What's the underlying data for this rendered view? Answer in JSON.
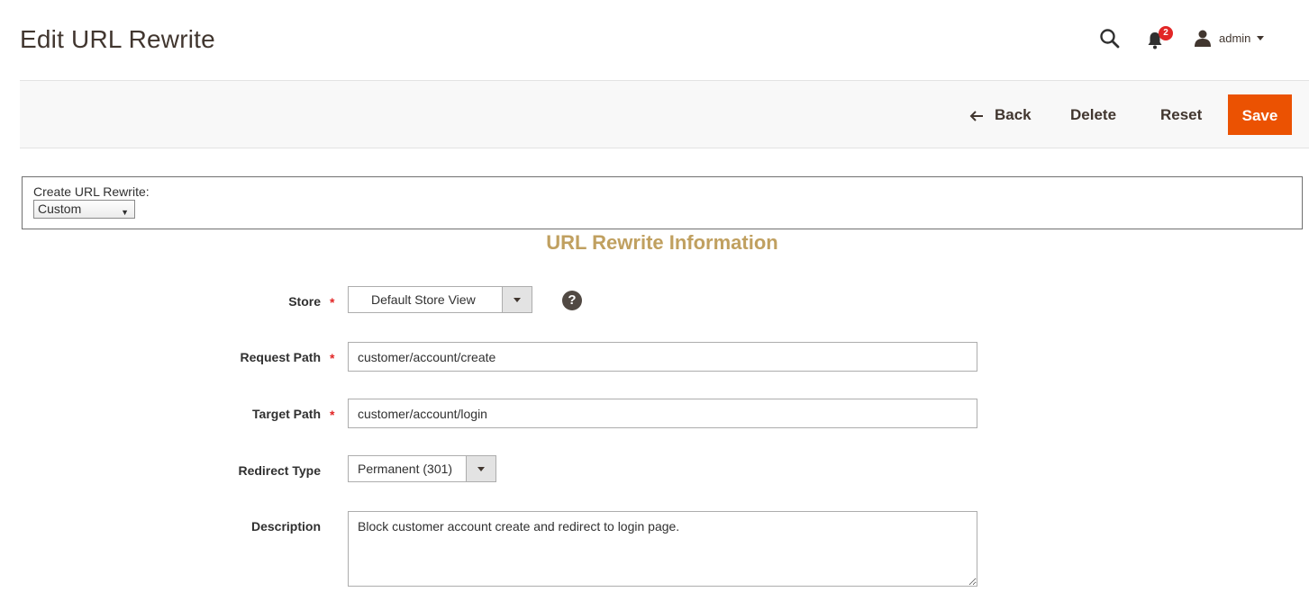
{
  "page": {
    "title": "Edit URL Rewrite"
  },
  "header": {
    "notification_count": "2",
    "user_name": "admin"
  },
  "actions": {
    "back_label": "Back",
    "delete_label": "Delete",
    "reset_label": "Reset",
    "save_label": "Save"
  },
  "create_rewrite": {
    "label": "Create URL Rewrite:",
    "selected": "Custom"
  },
  "section": {
    "title": "URL Rewrite Information"
  },
  "form": {
    "store": {
      "label": "Store",
      "required": "*",
      "value": "Default Store View"
    },
    "request_path": {
      "label": "Request Path",
      "required": "*",
      "value": "customer/account/create"
    },
    "target_path": {
      "label": "Target Path",
      "required": "*",
      "value": "customer/account/login"
    },
    "redirect_type": {
      "label": "Redirect Type",
      "value": "Permanent (301)"
    },
    "description": {
      "label": "Description",
      "value": "Block customer account create and redirect to login page."
    },
    "help_glyph": "?"
  },
  "colors": {
    "accent": "#eb5202",
    "title": "#41362f",
    "section_title": "#c0a060",
    "required": "#e22626"
  },
  "icons": {
    "search": "search-icon",
    "notifications": "bell-icon",
    "user": "user-icon",
    "back": "arrow-left-icon",
    "help": "help-icon"
  }
}
